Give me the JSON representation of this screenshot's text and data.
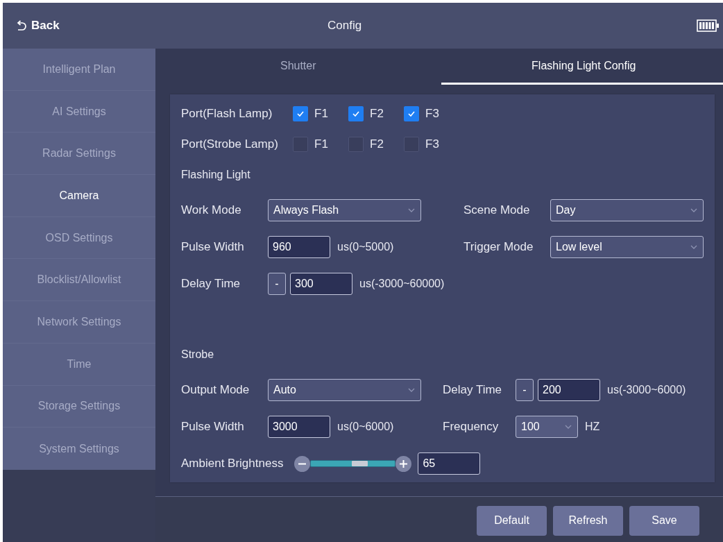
{
  "header": {
    "back": "Back",
    "title": "Config"
  },
  "sidebar": {
    "items": [
      {
        "label": "Intelligent Plan",
        "selected": false
      },
      {
        "label": "AI Settings",
        "selected": false
      },
      {
        "label": "Radar Settings",
        "selected": false
      },
      {
        "label": "Camera",
        "selected": true
      },
      {
        "label": "OSD Settings",
        "selected": false
      },
      {
        "label": "Blocklist/Allowlist",
        "selected": false
      },
      {
        "label": "Network Settings",
        "selected": false
      },
      {
        "label": "Time",
        "selected": false
      },
      {
        "label": "Storage Settings",
        "selected": false
      },
      {
        "label": "System Settings",
        "selected": false
      }
    ]
  },
  "tabs": [
    {
      "label": "Shutter",
      "selected": false
    },
    {
      "label": "Flashing Light Config",
      "selected": true
    }
  ],
  "ports": [
    {
      "label": "Port(Flash Lamp)",
      "options": [
        {
          "label": "F1",
          "checked": true
        },
        {
          "label": "F2",
          "checked": true
        },
        {
          "label": "F3",
          "checked": true
        }
      ]
    },
    {
      "label": "Port(Strobe Lamp)",
      "options": [
        {
          "label": "F1",
          "checked": false
        },
        {
          "label": "F2",
          "checked": false
        },
        {
          "label": "F3",
          "checked": false
        }
      ]
    }
  ],
  "flashing_light": {
    "heading": "Flashing Light",
    "rows": [
      {
        "fields": [
          {
            "kind": "dropdown",
            "label": "Work Mode",
            "value": "Always Flash"
          },
          {
            "kind": "dropdown",
            "label": "Scene Mode",
            "value": "Day"
          }
        ]
      },
      {
        "fields": [
          {
            "kind": "number",
            "label": "Pulse Width",
            "value": "960",
            "unit": "us(0~5000)"
          },
          {
            "kind": "dropdown",
            "label": "Trigger Mode",
            "value": "Low level"
          }
        ]
      },
      {
        "fields": [
          {
            "kind": "signed",
            "label": "Delay Time",
            "sign": "-",
            "value": "300",
            "unit": "us(-3000~60000)"
          }
        ]
      }
    ]
  },
  "strobe": {
    "heading": "Strobe",
    "rows": [
      {
        "fields": [
          {
            "kind": "dropdown",
            "label": "Output Mode",
            "value": "Auto"
          },
          {
            "kind": "signed",
            "label": "Delay Time",
            "sign": "-",
            "value": "200",
            "unit": "us(-3000~6000)"
          }
        ]
      },
      {
        "fields": [
          {
            "kind": "number",
            "label": "Pulse Width",
            "value": "3000",
            "unit": "us(0~6000)"
          },
          {
            "kind": "small_dropdown",
            "label": "Frequency",
            "value": "100",
            "unit": "HZ"
          }
        ]
      },
      {
        "fields": [
          {
            "kind": "slider",
            "label": "Ambient Brightness",
            "level": 0.6,
            "value": "65"
          }
        ]
      }
    ]
  },
  "buttons": [
    {
      "label": "Default"
    },
    {
      "label": "Refresh"
    },
    {
      "label": "Save"
    }
  ]
}
